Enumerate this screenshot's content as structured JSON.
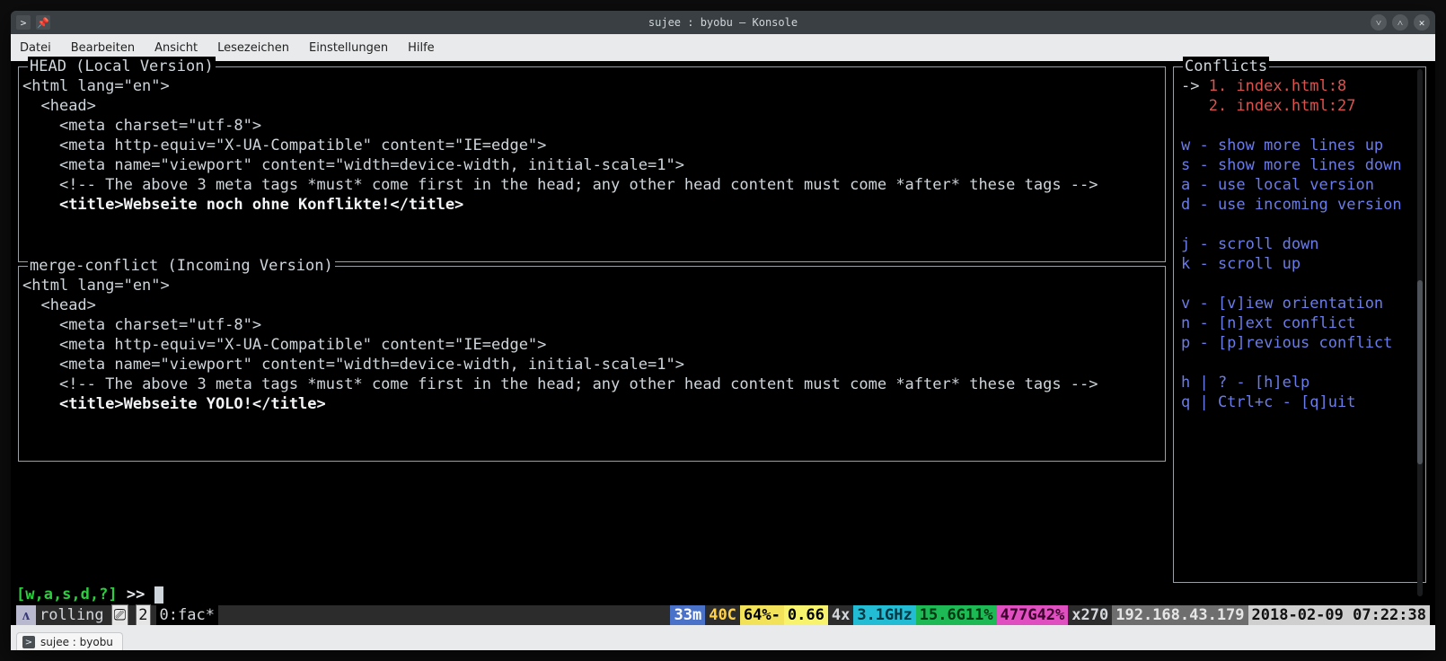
{
  "window": {
    "title": "sujee : byobu — Konsole"
  },
  "menubar": [
    "Datei",
    "Bearbeiten",
    "Ansicht",
    "Lesezeichen",
    "Einstellungen",
    "Hilfe"
  ],
  "head_block": {
    "title": "HEAD  (Local Version)",
    "lines": [
      {
        "text": "<html lang=\"en\">",
        "bold": false
      },
      {
        "text": "  <head>",
        "bold": false
      },
      {
        "text": "    <meta charset=\"utf-8\">",
        "bold": false
      },
      {
        "text": "    <meta http-equiv=\"X-UA-Compatible\" content=\"IE=edge\">",
        "bold": false
      },
      {
        "text": "    <meta name=\"viewport\" content=\"width=device-width, initial-scale=1\">",
        "bold": false
      },
      {
        "text": "    <!-- The above 3 meta tags *must* come first in the head; any other head content must come *after* these tags -->",
        "bold": false
      },
      {
        "text": "    <title>Webseite noch ohne Konflikte!</title>",
        "bold": true
      }
    ]
  },
  "merge_block": {
    "title": "merge-conflict  (Incoming Version)",
    "lines": [
      {
        "text": "<html lang=\"en\">",
        "bold": false
      },
      {
        "text": "  <head>",
        "bold": false
      },
      {
        "text": "    <meta charset=\"utf-8\">",
        "bold": false
      },
      {
        "text": "    <meta http-equiv=\"X-UA-Compatible\" content=\"IE=edge\">",
        "bold": false
      },
      {
        "text": "    <meta name=\"viewport\" content=\"width=device-width, initial-scale=1\">",
        "bold": false
      },
      {
        "text": "    <!-- The above 3 meta tags *must* come first in the head; any other head content must come *after* these tags -->",
        "bold": false
      },
      {
        "text": "    <title>Webseite YOLO!</title>",
        "bold": true
      }
    ]
  },
  "conflicts": {
    "title": "Conflicts",
    "items": [
      {
        "pointer": "-> ",
        "label": "1. index.html:8"
      },
      {
        "pointer": "   ",
        "label": "2. index.html:27"
      }
    ]
  },
  "hints": [
    "w - show more lines up",
    "s - show more lines down",
    "a - use local version",
    "d - use incoming version",
    "",
    "j - scroll down",
    "k - scroll up",
    "",
    "v - [v]iew orientation",
    "n - [n]ext conflict",
    "p - [p]revious conflict",
    "",
    "h | ? - [h]elp",
    "q | Ctrl+c - [q]uit"
  ],
  "prompt": {
    "bracket": "[w,a,s,d,?]",
    "arrows": " >> "
  },
  "status": {
    "logo": "ᴧ",
    "distro": " rolling",
    "session_count": "2",
    "win": "0:fac*",
    "uptime": "33m",
    "temp": "40C",
    "bat": "64%-",
    "load": "0.66",
    "cores": "4x",
    "ghz": "3.1GHz",
    "mem": "15.6G11%",
    "disk": "477G42%",
    "machine": "x270",
    "ip": "192.168.43.179",
    "date": "2018-02-09 07:22:38"
  },
  "tab": {
    "label": "sujee : byobu"
  }
}
